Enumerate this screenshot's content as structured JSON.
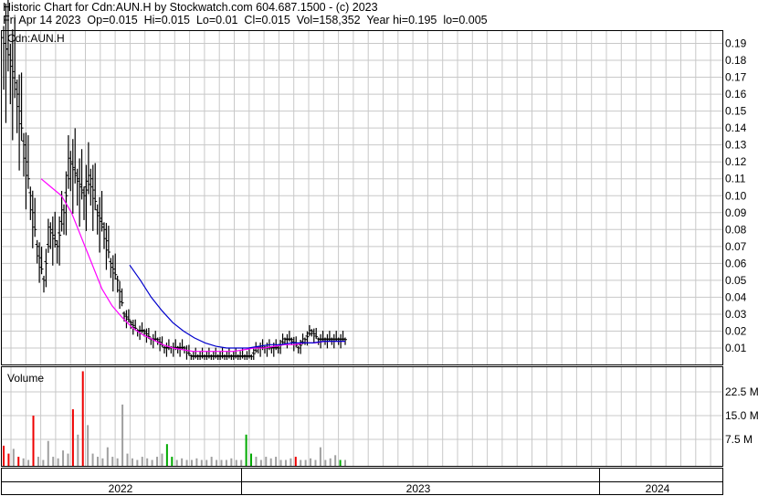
{
  "header": {
    "title": "Historic Chart for Cdn:AUN.H by Stockwatch.com 604.687.1500 - (c) 2023",
    "stats": "Fri Apr 14 2023  Op=0.015  Hi=0.015  Lo=0.01  Cl=0.015  Vol=158,352  Year hi=0.195  lo=0.005"
  },
  "chart_data": [
    {
      "type": "bar",
      "subtype": "ohlc",
      "title": "Cdn:AUN.H",
      "y_ticks": [
        "0.19",
        "0.18",
        "0.17",
        "0.16",
        "0.15",
        "0.14",
        "0.13",
        "0.12",
        "0.11",
        "0.10",
        "0.09",
        "0.08",
        "0.07",
        "0.06",
        "0.05",
        "0.04",
        "0.03",
        "0.02",
        "0.01"
      ],
      "ylim": [
        0.0,
        0.19
      ],
      "x_ticks": [
        "2022",
        "2023",
        "2024"
      ],
      "grid": true,
      "legend": "none",
      "price_series": {
        "color": "#000000",
        "approx_close": [
          0.19,
          0.18,
          0.16,
          0.13,
          0.1,
          0.07,
          0.05,
          0.08,
          0.07,
          0.09,
          0.12,
          0.11,
          0.1,
          0.11,
          0.09,
          0.08,
          0.06,
          0.05,
          0.03,
          0.025,
          0.02,
          0.02,
          0.015,
          0.015,
          0.01,
          0.01,
          0.01,
          0.01,
          0.005,
          0.005,
          0.005,
          0.005,
          0.005,
          0.005,
          0.005,
          0.005,
          0.005,
          0.005,
          0.01,
          0.01,
          0.01,
          0.01,
          0.015,
          0.015,
          0.01,
          0.015,
          0.02,
          0.015,
          0.015,
          0.015,
          0.015,
          0.015
        ]
      },
      "moving_averages": [
        {
          "color": "#ff00ff",
          "values": [
            0.11,
            0.105,
            0.1,
            0.09,
            0.075,
            0.06,
            0.045,
            0.035,
            0.028,
            0.022,
            0.018,
            0.015,
            0.012,
            0.01,
            0.009,
            0.008,
            0.008,
            0.008,
            0.008,
            0.008,
            0.009,
            0.01,
            0.01,
            0.011,
            0.012,
            0.012,
            0.013,
            0.013,
            0.014,
            0.014,
            0.014
          ]
        },
        {
          "color": "#0000cc",
          "values": [
            0.059,
            0.05,
            0.04,
            0.032,
            0.025,
            0.02,
            0.016,
            0.013,
            0.011,
            0.01,
            0.01,
            0.01,
            0.011,
            0.012,
            0.012,
            0.013,
            0.013,
            0.013,
            0.014,
            0.014,
            0.014
          ]
        }
      ]
    },
    {
      "type": "bar",
      "title": "Volume",
      "y_ticks": [
        "22.5 M",
        "15.0 M",
        "7.5 M"
      ],
      "ylim": [
        0,
        28
      ],
      "unit": "M",
      "colors": {
        "up": "#00aa00",
        "down": "#ee0000",
        "flat": "#a0a0a0"
      },
      "values": [
        {
          "v": 5.5,
          "c": "down"
        },
        {
          "v": 3,
          "c": "down"
        },
        {
          "v": 4.5,
          "c": "flat"
        },
        {
          "v": 2,
          "c": "down"
        },
        {
          "v": 1.5,
          "c": "flat"
        },
        {
          "v": 1,
          "c": "flat"
        },
        {
          "v": 15,
          "c": "down"
        },
        {
          "v": 2,
          "c": "flat"
        },
        {
          "v": 1,
          "c": "flat"
        },
        {
          "v": 7,
          "c": "flat"
        },
        {
          "v": 2,
          "c": "flat"
        },
        {
          "v": 1.5,
          "c": "flat"
        },
        {
          "v": 4,
          "c": "flat"
        },
        {
          "v": 3,
          "c": "flat"
        },
        {
          "v": 17,
          "c": "down"
        },
        {
          "v": 9,
          "c": "flat"
        },
        {
          "v": 29,
          "c": "down"
        },
        {
          "v": 12,
          "c": "flat"
        },
        {
          "v": 3,
          "c": "flat"
        },
        {
          "v": 2,
          "c": "flat"
        },
        {
          "v": 1.5,
          "c": "flat"
        },
        {
          "v": 5,
          "c": "flat"
        },
        {
          "v": 2,
          "c": "flat"
        },
        {
          "v": 1.5,
          "c": "flat"
        },
        {
          "v": 18.5,
          "c": "flat"
        },
        {
          "v": 3,
          "c": "flat"
        },
        {
          "v": 1.5,
          "c": "flat"
        },
        {
          "v": 1,
          "c": "flat"
        },
        {
          "v": 2,
          "c": "flat"
        },
        {
          "v": 1.5,
          "c": "flat"
        },
        {
          "v": 1,
          "c": "flat"
        },
        {
          "v": 2,
          "c": "flat"
        },
        {
          "v": 3,
          "c": "flat"
        },
        {
          "v": 6,
          "c": "up"
        },
        {
          "v": 2,
          "c": "up"
        },
        {
          "v": 1,
          "c": "flat"
        },
        {
          "v": 1.5,
          "c": "flat"
        },
        {
          "v": 1,
          "c": "flat"
        },
        {
          "v": 1,
          "c": "flat"
        },
        {
          "v": 1.5,
          "c": "flat"
        },
        {
          "v": 1,
          "c": "flat"
        },
        {
          "v": 1,
          "c": "flat"
        },
        {
          "v": 2,
          "c": "flat"
        },
        {
          "v": 1,
          "c": "flat"
        },
        {
          "v": 1,
          "c": "flat"
        },
        {
          "v": 1,
          "c": "flat"
        },
        {
          "v": 1.5,
          "c": "flat"
        },
        {
          "v": 1,
          "c": "flat"
        },
        {
          "v": 1,
          "c": "flat"
        },
        {
          "v": 9,
          "c": "up"
        },
        {
          "v": 3,
          "c": "up"
        },
        {
          "v": 2,
          "c": "flat"
        },
        {
          "v": 1,
          "c": "flat"
        },
        {
          "v": 2,
          "c": "flat"
        },
        {
          "v": 1.5,
          "c": "flat"
        },
        {
          "v": 2,
          "c": "flat"
        },
        {
          "v": 1,
          "c": "flat"
        },
        {
          "v": 1,
          "c": "flat"
        },
        {
          "v": 1.5,
          "c": "flat"
        },
        {
          "v": 2,
          "c": "down"
        },
        {
          "v": 1,
          "c": "flat"
        },
        {
          "v": 1,
          "c": "flat"
        },
        {
          "v": 1.5,
          "c": "flat"
        },
        {
          "v": 1,
          "c": "flat"
        },
        {
          "v": 5,
          "c": "flat"
        },
        {
          "v": 1,
          "c": "flat"
        },
        {
          "v": 1.5,
          "c": "flat"
        },
        {
          "v": 2.5,
          "c": "flat"
        },
        {
          "v": 1,
          "c": "up"
        },
        {
          "v": 1,
          "c": "flat"
        }
      ]
    }
  ]
}
